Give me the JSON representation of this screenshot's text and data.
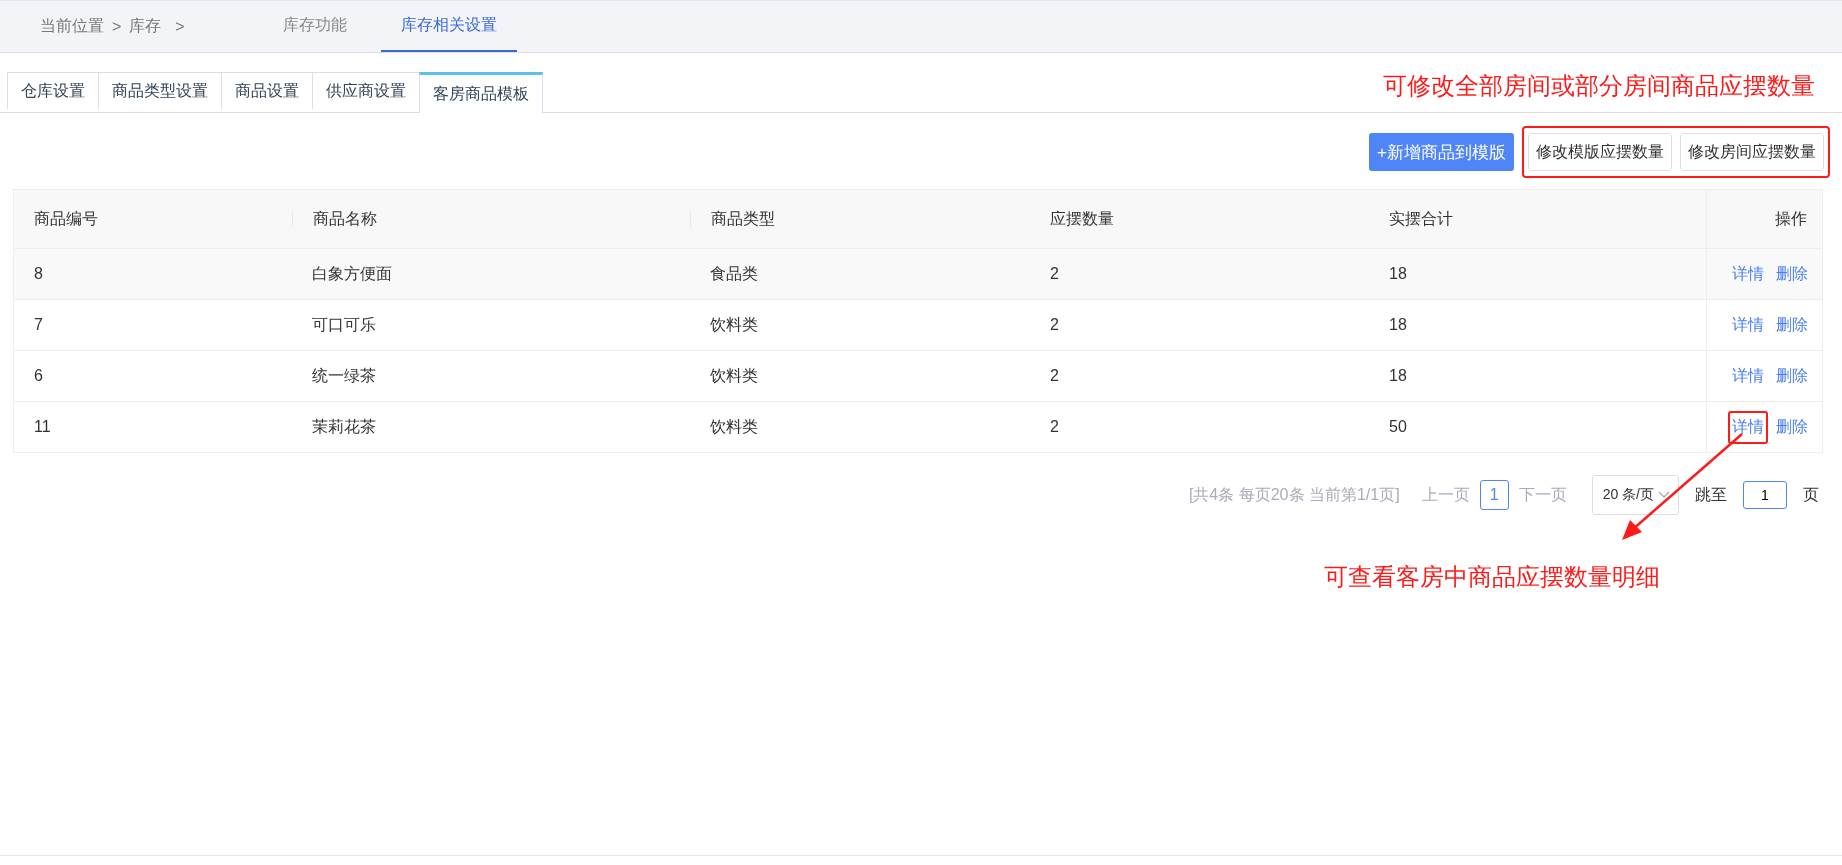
{
  "breadcrumb": {
    "label": "当前位置",
    "separator_1": ">",
    "current": "库存",
    "separator_2": ">"
  },
  "nav_tabs": [
    {
      "label": "库存功能",
      "selected": false
    },
    {
      "label": "库存相关设置",
      "selected": true
    }
  ],
  "sub_tabs": [
    {
      "label": "仓库设置",
      "selected": false
    },
    {
      "label": "商品类型设置",
      "selected": false
    },
    {
      "label": "商品设置",
      "selected": false
    },
    {
      "label": "供应商设置",
      "selected": false
    },
    {
      "label": "客房商品模板",
      "selected": true
    }
  ],
  "note_top": "可修改全部房间或部分房间商品应摆数量",
  "toolbar": {
    "add_button": "+新增商品到模版",
    "edit_buttons": [
      "修改模版应摆数量",
      "修改房间应摆数量"
    ],
    "edit_buttons_outlined": true
  },
  "table": {
    "columns": [
      "商品编号",
      "商品名称",
      "商品类型",
      "应摆数量",
      "实摆合计",
      "操作"
    ],
    "rows": [
      {
        "cells": [
          "8",
          "白象方便面",
          "食品类",
          "2",
          "18"
        ],
        "actions": [
          "详情",
          "删除"
        ],
        "detail_outlined": false
      },
      {
        "cells": [
          "7",
          "可口可乐",
          "饮料类",
          "2",
          "18"
        ],
        "actions": [
          "详情",
          "删除"
        ],
        "detail_outlined": false
      },
      {
        "cells": [
          "6",
          "统一绿茶",
          "饮料类",
          "2",
          "18"
        ],
        "actions": [
          "详情",
          "删除"
        ],
        "detail_outlined": false
      },
      {
        "cells": [
          "11",
          "茉莉花茶",
          "饮料类",
          "2",
          "50"
        ],
        "actions": [
          "详情",
          "删除"
        ],
        "detail_outlined": true
      }
    ]
  },
  "pagination": {
    "summary": "[共4条 每页20条 当前第1/1页]",
    "prev": "上一页",
    "page": "1",
    "next": "下一页",
    "page_size": "20 条/页",
    "jump_label": "跳至",
    "jump_value": "1",
    "jump_unit": "页"
  },
  "note_bottom": "可查看客房中商品应摆数量明细"
}
